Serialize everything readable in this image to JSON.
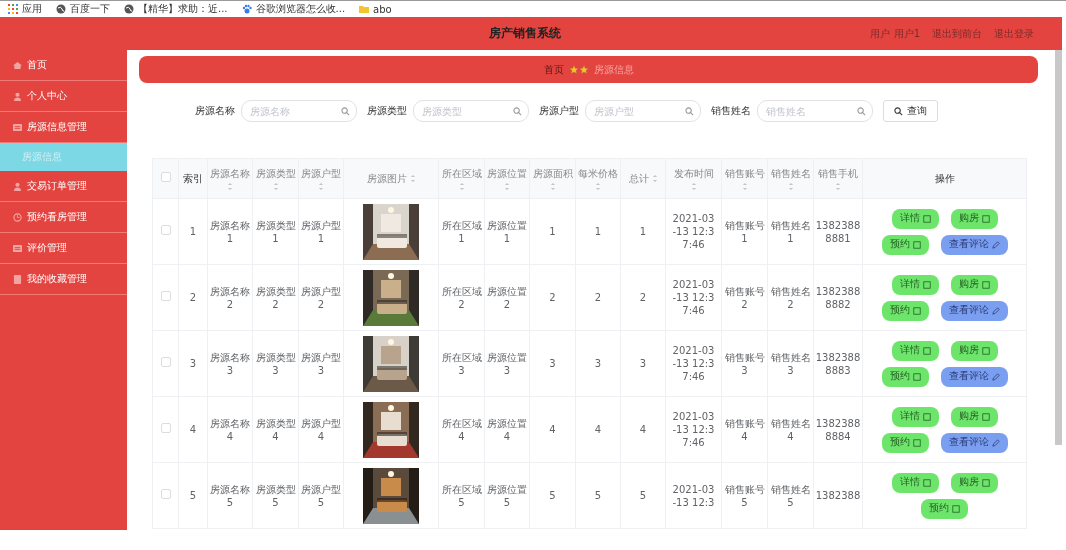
{
  "bookmarks": [
    {
      "kind": "apps",
      "label": "应用"
    },
    {
      "kind": "globe",
      "label": "百度一下"
    },
    {
      "kind": "globe",
      "label": "【精华】求助：近..."
    },
    {
      "kind": "paw",
      "label": "谷歌浏览器怎么收..."
    },
    {
      "kind": "folder",
      "label": "abo"
    }
  ],
  "header": {
    "title": "房产销售系统",
    "links": [
      "用户 用户1",
      "退出到前台",
      "退出登录"
    ]
  },
  "sidebar": {
    "items": [
      {
        "label": "首页",
        "kind": "home",
        "selected": false
      },
      {
        "label": "个人中心",
        "kind": "person",
        "selected": false
      },
      {
        "label": "房源信息管理",
        "kind": "list",
        "selected": false,
        "children": [
          {
            "label": "房源信息",
            "selected": true
          }
        ]
      },
      {
        "label": "交易订单管理",
        "kind": "person",
        "selected": false
      },
      {
        "label": "预约看房管理",
        "kind": "clock",
        "selected": false
      },
      {
        "label": "评价管理",
        "kind": "list",
        "selected": false
      },
      {
        "label": "我的收藏管理",
        "kind": "doc",
        "selected": false
      }
    ]
  },
  "breadcrumb": {
    "home": "首页",
    "current": "房源信息"
  },
  "search": {
    "fields": [
      {
        "label": "房源名称",
        "placeholder": "房源名称"
      },
      {
        "label": "房源类型",
        "placeholder": "房源类型"
      },
      {
        "label": "房源户型",
        "placeholder": "房源户型"
      },
      {
        "label": "销售姓名",
        "placeholder": "销售姓名"
      }
    ],
    "button": "查询"
  },
  "table": {
    "columns": [
      {
        "kind": "checkbox",
        "checked": false
      },
      {
        "label": "索引",
        "sortable": false
      },
      {
        "label": "房源名称",
        "sortable": true
      },
      {
        "label": "房源类型",
        "sortable": true
      },
      {
        "label": "房源户型",
        "sortable": true
      },
      {
        "label": "房源图片",
        "sortable": true
      },
      {
        "label": "所在区域",
        "sortable": true
      },
      {
        "label": "房源位置",
        "sortable": true
      },
      {
        "label": "房源面积",
        "sortable": true
      },
      {
        "label": "每米价格",
        "sortable": true
      },
      {
        "label": "总计",
        "sortable": true
      },
      {
        "label": "发布时间",
        "sortable": true
      },
      {
        "label": "销售账号",
        "sortable": true
      },
      {
        "label": "销售姓名",
        "sortable": true
      },
      {
        "label": "销售手机",
        "sortable": true
      },
      {
        "label": "操作",
        "sortable": false
      }
    ],
    "rows": [
      {
        "checked": false,
        "cells": [
          {
            "kind": "checkbox"
          },
          "1",
          "房源名称\n1",
          "房源类型\n1",
          "房源户型\n1",
          {
            "kind": "picture"
          },
          "所在区域\n1",
          "房源位置\n1",
          "1",
          "1",
          "1",
          "2021-03\n-13 12:3\n7:46",
          "销售账号\n1",
          "销售姓名\n1",
          "1382388\n8881",
          {
            "kind": "actions",
            "buttons": [
              {
                "label": "详情",
                "kind": "primary"
              },
              {
                "label": "购房",
                "kind": "primary"
              },
              {
                "label": "预约",
                "kind": "primary"
              },
              {
                "label": "查看评论",
                "kind": "secondary"
              }
            ]
          }
        ]
      },
      {
        "checked": false,
        "cells": [
          {
            "kind": "checkbox"
          },
          "2",
          "房源名称\n2",
          "房源类型\n2",
          "房源户型\n2",
          {
            "kind": "picture"
          },
          "所在区域\n2",
          "房源位置\n2",
          "2",
          "2",
          "2",
          "2021-03\n-13 12:3\n7:46",
          "销售账号\n2",
          "销售姓名\n2",
          "1382388\n8882",
          {
            "kind": "actions",
            "buttons": [
              {
                "label": "详情",
                "kind": "primary"
              },
              {
                "label": "购房",
                "kind": "primary"
              },
              {
                "label": "预约",
                "kind": "primary"
              },
              {
                "label": "查看评论",
                "kind": "secondary"
              }
            ]
          }
        ]
      },
      {
        "checked": false,
        "cells": [
          {
            "kind": "checkbox"
          },
          "3",
          "房源名称\n3",
          "房源类型\n3",
          "房源户型\n3",
          {
            "kind": "picture"
          },
          "所在区域\n3",
          "房源位置\n3",
          "3",
          "3",
          "3",
          "2021-03\n-13 12:3\n7:46",
          "销售账号\n3",
          "销售姓名\n3",
          "1382388\n8883",
          {
            "kind": "actions",
            "buttons": [
              {
                "label": "详情",
                "kind": "primary"
              },
              {
                "label": "购房",
                "kind": "primary"
              },
              {
                "label": "预约",
                "kind": "primary"
              },
              {
                "label": "查看评论",
                "kind": "secondary"
              }
            ]
          }
        ]
      },
      {
        "checked": false,
        "cells": [
          {
            "kind": "checkbox"
          },
          "4",
          "房源名称\n4",
          "房源类型\n4",
          "房源户型\n4",
          {
            "kind": "picture"
          },
          "所在区域\n4",
          "房源位置\n4",
          "4",
          "4",
          "4",
          "2021-03\n-13 12:3\n7:46",
          "销售账号\n4",
          "销售姓名\n4",
          "1382388\n8884",
          {
            "kind": "actions",
            "buttons": [
              {
                "label": "详情",
                "kind": "primary"
              },
              {
                "label": "购房",
                "kind": "primary"
              },
              {
                "label": "预约",
                "kind": "primary"
              },
              {
                "label": "查看评论",
                "kind": "secondary"
              }
            ]
          }
        ]
      },
      {
        "checked": false,
        "cells": [
          {
            "kind": "checkbox"
          },
          "5",
          "房源名称\n5",
          "房源类型\n5",
          "房源户型\n5",
          {
            "kind": "picture"
          },
          "所在区域\n5",
          "房源位置\n5",
          "5",
          "5",
          "5",
          "2021-03\n-13 12:3",
          "销售账号\n5",
          "销售姓名\n5",
          "1382388",
          {
            "kind": "actions",
            "buttons": [
              {
                "label": "详情",
                "kind": "primary"
              },
              {
                "label": "购房",
                "kind": "primary"
              },
              {
                "label": "预约",
                "kind": "primary"
              }
            ]
          }
        ]
      }
    ]
  }
}
